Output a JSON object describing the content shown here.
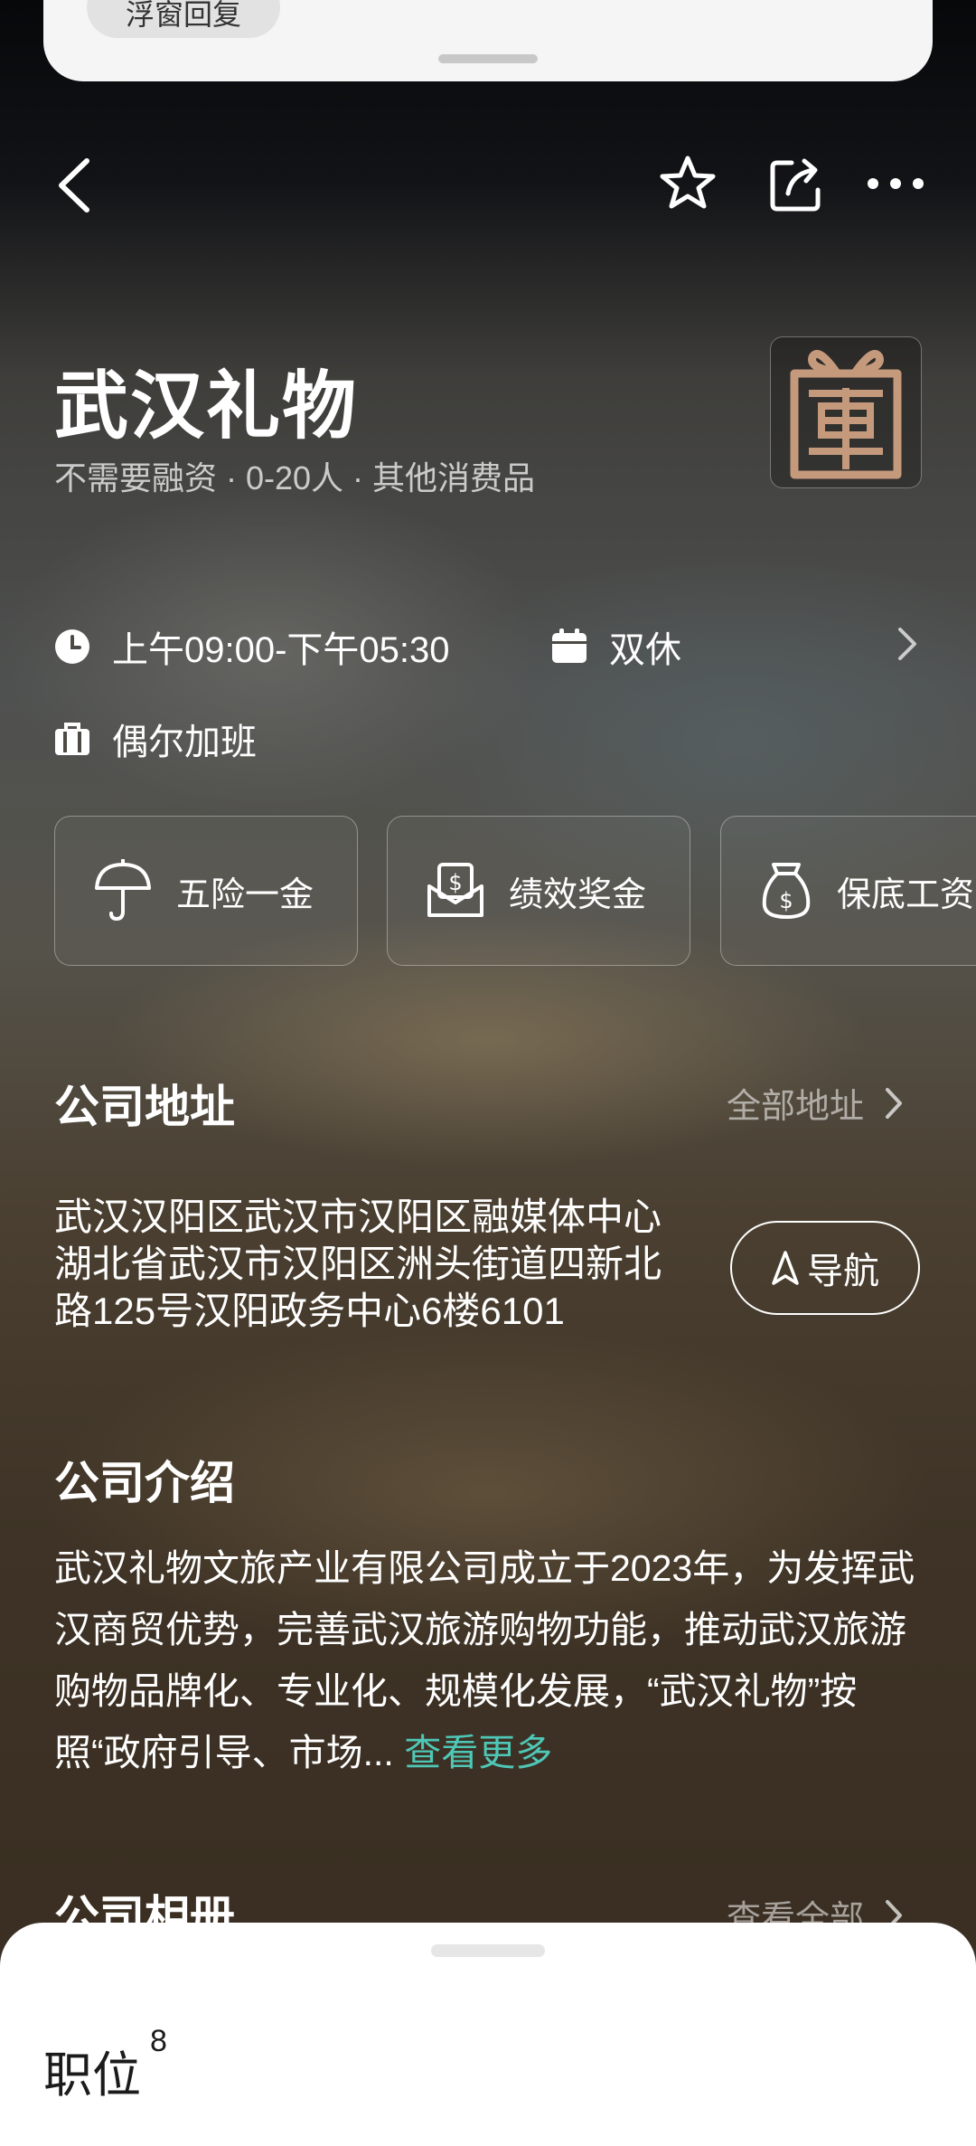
{
  "notification": {
    "action_label": "浮窗回复"
  },
  "company": {
    "name": "武汉礼物",
    "tags": "不需要融资 · 0-20人 · 其他消费品"
  },
  "work": {
    "hours": "上午09:00-下午05:30",
    "rest": "双休",
    "overtime": "偶尔加班"
  },
  "benefits": [
    "五险一金",
    "绩效奖金",
    "保底工资"
  ],
  "address_section": {
    "title": "公司地址",
    "all_link": "全部地址",
    "address": "武汉汉阳区武汉市汉阳区融媒体中心湖北省武汉市汉阳区洲头街道四新北路125号汉阳政务中心6楼6101",
    "nav_button": "导航"
  },
  "intro_section": {
    "title": "公司介绍",
    "text": "武汉礼物文旅产业有限公司成立于2023年，为发挥武汉商贸优势，完善武汉旅游购物功能，推动武汉旅游购物品牌化、专业化、规模化发展，“武汉礼物”按照“政府引导、市场...",
    "more_link": "查看更多"
  },
  "album_section": {
    "title": "公司相册",
    "all_link": "查看全部"
  },
  "bottom_sheet": {
    "title": "职位",
    "count": "8"
  },
  "colors": {
    "accent_link": "#4fc7b6",
    "logo_brown": "#c59a7c"
  }
}
